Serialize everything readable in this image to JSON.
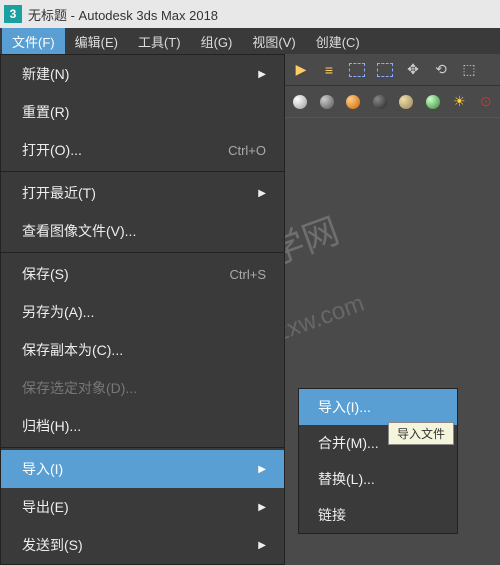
{
  "titlebar": {
    "app_icon_text": "3",
    "title": "无标题 - Autodesk 3ds Max 2018"
  },
  "menubar": {
    "items": [
      {
        "label": "文件(F)",
        "active": true
      },
      {
        "label": "编辑(E)"
      },
      {
        "label": "工具(T)"
      },
      {
        "label": "组(G)"
      },
      {
        "label": "视图(V)"
      },
      {
        "label": "创建(C)"
      }
    ]
  },
  "file_menu": {
    "entries": [
      {
        "label": "新建(N)",
        "submenu": true
      },
      {
        "label": "重置(R)"
      },
      {
        "label": "打开(O)...",
        "shortcut": "Ctrl+O"
      },
      {
        "sep": true
      },
      {
        "label": "打开最近(T)",
        "submenu": true
      },
      {
        "label": "查看图像文件(V)..."
      },
      {
        "sep": true
      },
      {
        "label": "保存(S)",
        "shortcut": "Ctrl+S"
      },
      {
        "label": "另存为(A)..."
      },
      {
        "label": "保存副本为(C)..."
      },
      {
        "label": "保存选定对象(D)...",
        "disabled": true
      },
      {
        "label": "归档(H)..."
      },
      {
        "sep": true
      },
      {
        "label": "导入(I)",
        "submenu": true,
        "highlighted": true
      },
      {
        "label": "导出(E)",
        "submenu": true
      },
      {
        "label": "发送到(S)",
        "submenu": true
      }
    ]
  },
  "import_submenu": {
    "entries": [
      {
        "label": "导入(I)...",
        "highlighted": true
      },
      {
        "label": "合并(M)..."
      },
      {
        "label": "替换(L)..."
      },
      {
        "label": "链接"
      }
    ]
  },
  "tooltip": {
    "text": "导入文件"
  },
  "watermark": {
    "line1": "CAD自学网",
    "line2": "www.cadzxw.com"
  }
}
